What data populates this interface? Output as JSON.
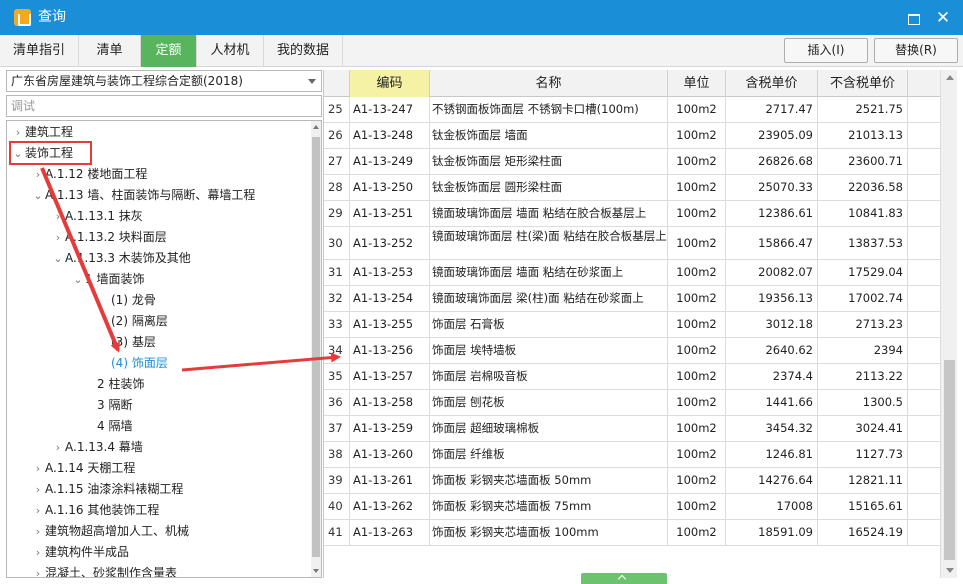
{
  "window": {
    "title": "查询",
    "maximize_icon": "maximize-icon",
    "close_symbol": "✕"
  },
  "tabs": [
    {
      "label": "清单指引",
      "active": false
    },
    {
      "label": "清单",
      "active": false
    },
    {
      "label": "定额",
      "active": true
    },
    {
      "label": "人材机",
      "active": false
    },
    {
      "label": "我的数据",
      "active": false
    }
  ],
  "toolbar": {
    "insert_label": "插入(I)",
    "replace_label": "替换(R)"
  },
  "left": {
    "library": "广东省房屋建筑与装饰工程综合定额(2018)",
    "search_placeholder": "调试",
    "tree": [
      {
        "label": "建筑工程",
        "chev": "›"
      },
      {
        "label": "装饰工程",
        "chev": "⌄"
      },
      {
        "label": "A.1.12 楼地面工程",
        "chev": "›"
      },
      {
        "label": "A.1.13 墙、柱面装饰与隔断、幕墙工程",
        "chev": "⌄"
      },
      {
        "label": "A.1.13.1 抹灰",
        "chev": "›"
      },
      {
        "label": "A.1.13.2 块料面层",
        "chev": "›"
      },
      {
        "label": "A.1.13.3 木装饰及其他",
        "chev": "⌄"
      },
      {
        "label": "1 墙面装饰",
        "chev": "⌄"
      },
      {
        "label": "(1) 龙骨",
        "chev": ""
      },
      {
        "label": "(2) 隔离层",
        "chev": ""
      },
      {
        "label": "(3) 基层",
        "chev": ""
      },
      {
        "label": "(4) 饰面层",
        "chev": ""
      },
      {
        "label": "2 柱装饰",
        "chev": ""
      },
      {
        "label": "3 隔断",
        "chev": ""
      },
      {
        "label": "4 隔墙",
        "chev": ""
      },
      {
        "label": "A.1.13.4 幕墙",
        "chev": "›"
      },
      {
        "label": "A.1.14 天棚工程",
        "chev": "›"
      },
      {
        "label": "A.1.15 油漆涂料裱糊工程",
        "chev": "›"
      },
      {
        "label": "A.1.16 其他装饰工程",
        "chev": "›"
      },
      {
        "label": "建筑物超高增加人工、机械",
        "chev": "›"
      },
      {
        "label": "建筑构件半成品",
        "chev": "›"
      },
      {
        "label": "混凝土、砂浆制作含量表",
        "chev": "›"
      }
    ]
  },
  "grid": {
    "headers": [
      "",
      "编码",
      "名称",
      "单位",
      "含税单价",
      "不含税单价"
    ],
    "rows": [
      {
        "no": "25",
        "code": "A1-13-247",
        "name": "不锈钢面板饰面层 不锈钢卡口槽(100m)",
        "unit": "100m2",
        "tax": "2717.47",
        "notax": "2521.75"
      },
      {
        "no": "26",
        "code": "A1-13-248",
        "name": "钛金板饰面层 墙面",
        "unit": "100m2",
        "tax": "23905.09",
        "notax": "21013.13"
      },
      {
        "no": "27",
        "code": "A1-13-249",
        "name": "钛金板饰面层 矩形梁柱面",
        "unit": "100m2",
        "tax": "26826.68",
        "notax": "23600.71"
      },
      {
        "no": "28",
        "code": "A1-13-250",
        "name": "钛金板饰面层 圆形梁柱面",
        "unit": "100m2",
        "tax": "25070.33",
        "notax": "22036.58"
      },
      {
        "no": "29",
        "code": "A1-13-251",
        "name": "镜面玻璃饰面层 墙面 粘结在胶合板基层上",
        "unit": "100m2",
        "tax": "12386.61",
        "notax": "10841.83"
      },
      {
        "no": "30",
        "code": "A1-13-252",
        "name": "镜面玻璃饰面层 柱(梁)面 粘结在胶合板基层上",
        "unit": "100m2",
        "tax": "15866.47",
        "notax": "13837.53"
      },
      {
        "no": "31",
        "code": "A1-13-253",
        "name": "镜面玻璃饰面层 墙面 粘结在砂浆面上",
        "unit": "100m2",
        "tax": "20082.07",
        "notax": "17529.04"
      },
      {
        "no": "32",
        "code": "A1-13-254",
        "name": "镜面玻璃饰面层 梁(柱)面 粘结在砂浆面上",
        "unit": "100m2",
        "tax": "19356.13",
        "notax": "17002.74"
      },
      {
        "no": "33",
        "code": "A1-13-255",
        "name": "饰面层 石膏板",
        "unit": "100m2",
        "tax": "3012.18",
        "notax": "2713.23"
      },
      {
        "no": "34",
        "code": "A1-13-256",
        "name": "饰面层 埃特墙板",
        "unit": "100m2",
        "tax": "2640.62",
        "notax": "2394"
      },
      {
        "no": "35",
        "code": "A1-13-257",
        "name": "饰面层 岩棉吸音板",
        "unit": "100m2",
        "tax": "2374.4",
        "notax": "2113.22"
      },
      {
        "no": "36",
        "code": "A1-13-258",
        "name": "饰面层 刨花板",
        "unit": "100m2",
        "tax": "1441.66",
        "notax": "1300.5"
      },
      {
        "no": "37",
        "code": "A1-13-259",
        "name": "饰面层 超细玻璃棉板",
        "unit": "100m2",
        "tax": "3454.32",
        "notax": "3024.41"
      },
      {
        "no": "38",
        "code": "A1-13-260",
        "name": "饰面层 纤维板",
        "unit": "100m2",
        "tax": "1246.81",
        "notax": "1127.73"
      },
      {
        "no": "39",
        "code": "A1-13-261",
        "name": "饰面板 彩钢夹芯墙面板 50mm",
        "unit": "100m2",
        "tax": "14276.64",
        "notax": "12821.11"
      },
      {
        "no": "40",
        "code": "A1-13-262",
        "name": "饰面板 彩钢夹芯墙面板 75mm",
        "unit": "100m2",
        "tax": "17008",
        "notax": "15165.61"
      },
      {
        "no": "41",
        "code": "A1-13-263",
        "name": "饰面板 彩钢夹芯墙面板 100mm",
        "unit": "100m2",
        "tax": "18591.09",
        "notax": "16524.19"
      }
    ]
  },
  "colors": {
    "titlebar": "#1a8fd8",
    "active_tab": "#58b55e",
    "annotation": "#e53b3b",
    "selected_text": "#1e8fe0"
  }
}
